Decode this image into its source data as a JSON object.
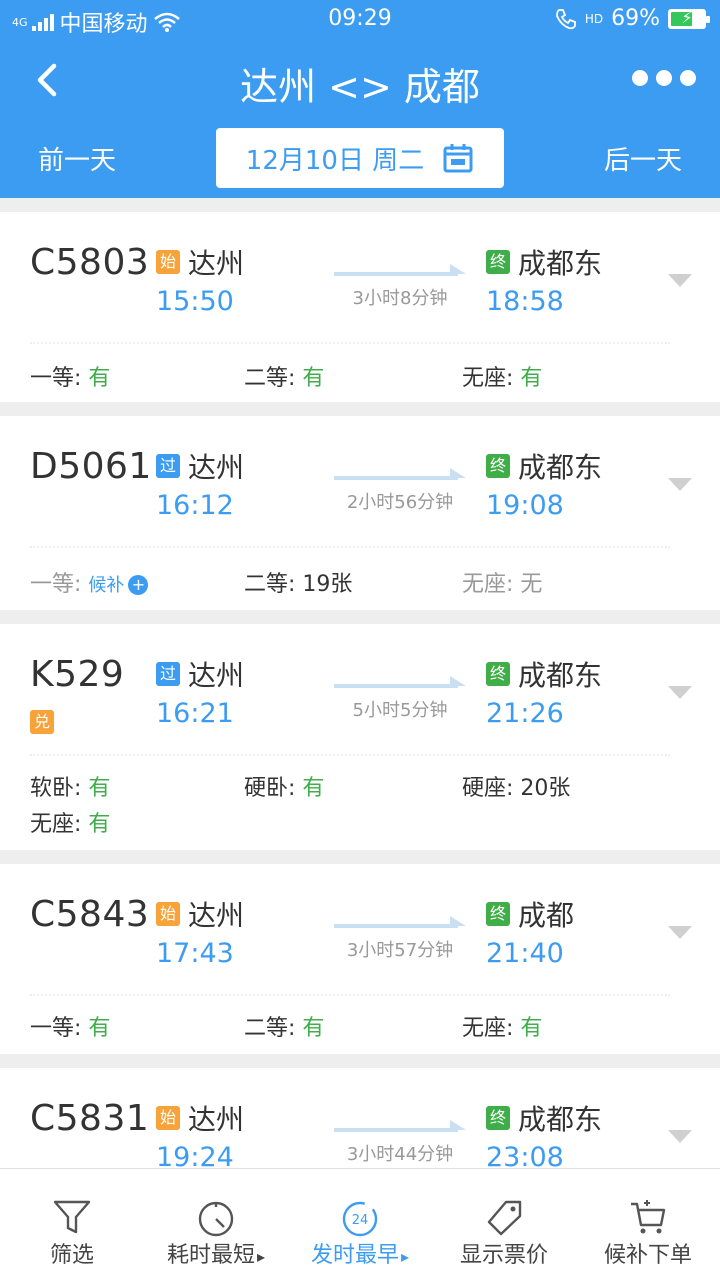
{
  "status_bar": {
    "network_type": "4G",
    "carrier": "中国移动",
    "time": "09:29",
    "hd_label": "HD",
    "battery": "69%",
    "battery_level": 0.69
  },
  "nav": {
    "title": "达州 <> 成都"
  },
  "date_bar": {
    "prev_label": "前一天",
    "date": "12月10日 周二",
    "next_label": "后一天"
  },
  "trains": [
    {
      "number": "C5803",
      "from_tag": "始",
      "from_station": "达州",
      "dep_time": "15:50",
      "duration": "3小时8分钟",
      "to_tag": "终",
      "to_station": "成都东",
      "arr_time": "18:58",
      "seats": [
        {
          "label": "一等: ",
          "value": "有"
        },
        {
          "label": "二等: ",
          "value": "有"
        },
        {
          "label": "无座: ",
          "value": "有"
        }
      ]
    },
    {
      "number": "D5061",
      "from_tag": "过",
      "from_station": "达州",
      "dep_time": "16:12",
      "duration": "2小时56分钟",
      "to_tag": "终",
      "to_station": "成都东",
      "arr_time": "19:08",
      "seats": [
        {
          "label": "一等: ",
          "value": "候补"
        },
        {
          "label": "二等: ",
          "value": "19张"
        },
        {
          "label": "无座: ",
          "value": "无"
        }
      ]
    },
    {
      "number": "K529",
      "exchange_tag": "兑",
      "from_tag": "过",
      "from_station": "达州",
      "dep_time": "16:21",
      "duration": "5小时5分钟",
      "to_tag": "终",
      "to_station": "成都东",
      "arr_time": "21:26",
      "seats": [
        {
          "label": "软卧: ",
          "value": "有"
        },
        {
          "label": "硬卧: ",
          "value": "有"
        },
        {
          "label": "硬座: ",
          "value": "20张"
        },
        {
          "label": "无座: ",
          "value": "有"
        }
      ]
    },
    {
      "number": "C5843",
      "from_tag": "始",
      "from_station": "达州",
      "dep_time": "17:43",
      "duration": "3小时57分钟",
      "to_tag": "终",
      "to_station": "成都",
      "arr_time": "21:40",
      "seats": [
        {
          "label": "一等: ",
          "value": "有"
        },
        {
          "label": "二等: ",
          "value": "有"
        },
        {
          "label": "无座: ",
          "value": "有"
        }
      ]
    },
    {
      "number": "C5831",
      "from_tag": "始",
      "from_station": "达州",
      "dep_time": "19:24",
      "duration": "3小时44分钟",
      "to_tag": "终",
      "to_station": "成都东",
      "arr_time": "23:08",
      "seats": []
    }
  ],
  "toolbar": {
    "filter": "筛选",
    "shortest": "耗时最短",
    "earliest": "发时最早",
    "earliest_icon_text": "24",
    "show_price": "显示票价",
    "waitlist_order": "候补下单"
  },
  "colors": {
    "primary": "#3c9cf2",
    "available": "#3fae49",
    "start_tag": "#f7a33a",
    "end_tag": "#3fae49"
  }
}
